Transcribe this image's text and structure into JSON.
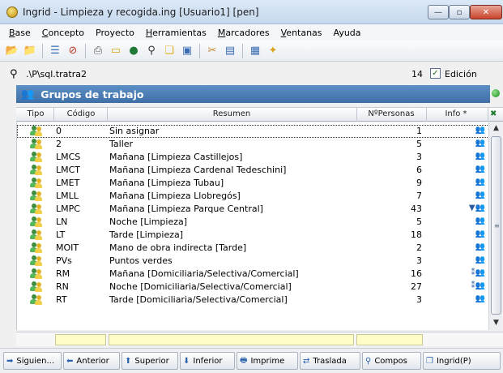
{
  "window": {
    "title": "Ingrid - Limpieza y recogida.ing  [Usuario1]  [pen]",
    "buttons": {
      "minimize": "—",
      "maximize": "▫",
      "close": "✕"
    }
  },
  "menubar": [
    {
      "label": "Base",
      "ul": "B",
      "rest": "ase"
    },
    {
      "label": "Concepto",
      "ul": "C",
      "rest": "oncepto"
    },
    {
      "label": "Proyecto",
      "ul": "P",
      "rest": "royecto"
    },
    {
      "label": "Herramientas",
      "ul": "H",
      "rest": "erramientas"
    },
    {
      "label": "Marcadores",
      "ul": "M",
      "rest": "arcadores"
    },
    {
      "label": "Ventanas",
      "ul": "V",
      "rest": "entanas"
    },
    {
      "label": "Ayuda",
      "ul": "A",
      "rest": "yuda"
    }
  ],
  "toolbar_icons": [
    "folder-open-icon",
    "folder-user-icon",
    "list-icon",
    "forbidden-icon",
    "printer-icon",
    "folder-icon",
    "globe-icon",
    "binoculars-icon",
    "copy-icon",
    "window-icon",
    "tools-icon",
    "chart-icon",
    "calendar-icon",
    "magic-icon"
  ],
  "pathbar": {
    "path": ".\\P\\sql.tratra2",
    "count": "14",
    "edit_label": "Edición",
    "edit_checked": true
  },
  "panel": {
    "title": "Grupos de trabajo"
  },
  "grid": {
    "columns": {
      "tipo": "Tipo",
      "codigo": "Código",
      "resumen": "Resumen",
      "personas": "NºPersonas",
      "info": "Info *"
    },
    "rows": [
      {
        "codigo": "0",
        "resumen": "Sin asignar",
        "personas": "1",
        "info": "👥",
        "selected": true
      },
      {
        "codigo": "2",
        "resumen": "Taller",
        "personas": "5",
        "info": "👥"
      },
      {
        "codigo": "LMCS",
        "resumen": "Mañana [Limpieza Castillejos]",
        "personas": "3",
        "info": "👥"
      },
      {
        "codigo": "LMCT",
        "resumen": "Mañana [Limpieza Cardenal Tedeschini]",
        "personas": "6",
        "info": "👥"
      },
      {
        "codigo": "LMET",
        "resumen": "Mañana [Limpieza Tubau]",
        "personas": "9",
        "info": "👥"
      },
      {
        "codigo": "LMLL",
        "resumen": "Mañana [Limpieza Llobregós]",
        "personas": "7",
        "info": "👥"
      },
      {
        "codigo": "LMPC",
        "resumen": "Mañana [Limpieza Parque Central]",
        "personas": "43",
        "info": "▼👥"
      },
      {
        "codigo": "LN",
        "resumen": "Noche [Limpieza]",
        "personas": "5",
        "info": "👥"
      },
      {
        "codigo": "LT",
        "resumen": "Tarde [Limpieza]",
        "personas": "18",
        "info": "👥"
      },
      {
        "codigo": "MOIT",
        "resumen": "Mano de obra indirecta [Tarde]",
        "personas": "2",
        "info": "👥"
      },
      {
        "codigo": "PVs",
        "resumen": "Puntos verdes",
        "personas": "3",
        "info": "👥"
      },
      {
        "codigo": "RM",
        "resumen": "Mañana [Domiciliaria/Selectiva/Comercial]",
        "personas": "16",
        "info": "⁑👥"
      },
      {
        "codigo": "RN",
        "resumen": "Noche [Domiciliaria/Selectiva/Comercial]",
        "personas": "27",
        "info": "⁑👥"
      },
      {
        "codigo": "RT",
        "resumen": "Tarde [Domiciliaria/Selectiva/Comercial]",
        "personas": "3",
        "info": "👥"
      }
    ]
  },
  "bottom_buttons": [
    {
      "icon": "➡",
      "label": "Siguien..."
    },
    {
      "icon": "⬅",
      "label": "Anterior"
    },
    {
      "icon": "⬆",
      "label": "Superior"
    },
    {
      "icon": "⬇",
      "label": "Inferior"
    },
    {
      "icon": "🖶",
      "label": "Imprime"
    },
    {
      "icon": "⇄",
      "label": "Traslada"
    },
    {
      "icon": "⚲",
      "label": "Compos"
    },
    {
      "icon": "❐",
      "label": "Ingrid(P)"
    }
  ]
}
